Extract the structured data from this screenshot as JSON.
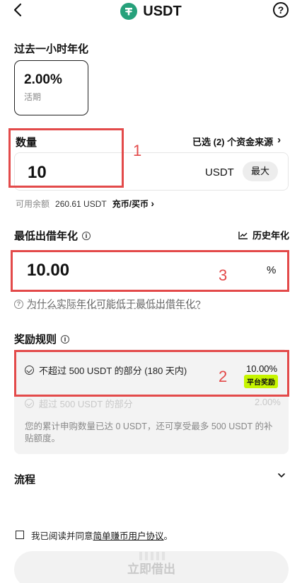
{
  "header": {
    "back_icon": "chevron-left-icon",
    "title": "USDT",
    "coin_icon": "tether-icon",
    "help_icon": "question-circle-icon"
  },
  "apr_section": {
    "label": "过去一小时年化",
    "card_value": "2.00%",
    "card_sub": "活期"
  },
  "amount_section": {
    "label": "数量",
    "sources_link": "已选 (2) 个资金来源",
    "sources_chevron": "›",
    "value": "10",
    "unit": "USDT",
    "max_label": "最大",
    "balance_label": "可用余额",
    "balance_value": "260.61 USDT",
    "recharge_link": "充币/买币",
    "recharge_chevron": "›"
  },
  "min_rate_section": {
    "label": "最低出借年化",
    "history_link": "历史年化",
    "value": "10.00",
    "unit": "%",
    "why_link": "为什么实际年化可能低于最低出借年化?"
  },
  "reward_section": {
    "label": "奖励规则",
    "rule1_text": "不超过 500 USDT 的部分 (180 天内)",
    "rule1_rate": "10.00%",
    "rule1_badge": "平台奖励",
    "rule2_text": "超过 500 USDT 的部分",
    "rule2_rate": "2.00%",
    "note": "您的累计申购数量已达 0 USDT，还可享受最多 500 USDT 的补贴额度。"
  },
  "process_section": {
    "label": "流程",
    "chevron": "⌄"
  },
  "agreement": {
    "text_prefix": "我已阅读并同意",
    "link_text": "简单赚币用户协议",
    "text_suffix": "。"
  },
  "cta": {
    "label": "立即借出"
  },
  "annotations": {
    "one": "1",
    "two": "2",
    "three": "3"
  },
  "colors": {
    "annotation_red": "#e34a4a",
    "tether_green": "#26a17b",
    "badge_green": "#c6f500"
  }
}
